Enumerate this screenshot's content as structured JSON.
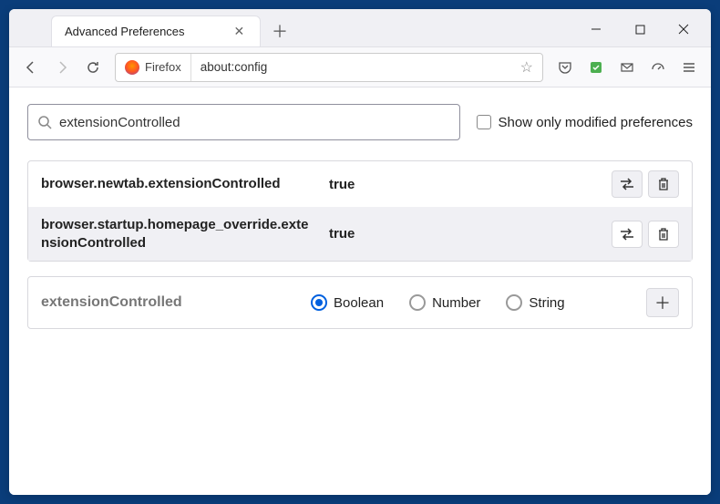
{
  "window": {
    "tab_title": "Advanced Preferences",
    "url_identity": "Firefox",
    "url": "about:config"
  },
  "search": {
    "value": "extensionControlled",
    "show_modified_label": "Show only modified preferences",
    "show_modified_checked": false
  },
  "prefs": [
    {
      "name": "browser.newtab.extensionControlled",
      "value": "true"
    },
    {
      "name": "browser.startup.homepage_override.extensionControlled",
      "value": "true"
    }
  ],
  "add": {
    "name": "extensionControlled",
    "types": [
      "Boolean",
      "Number",
      "String"
    ],
    "selected": "Boolean"
  }
}
